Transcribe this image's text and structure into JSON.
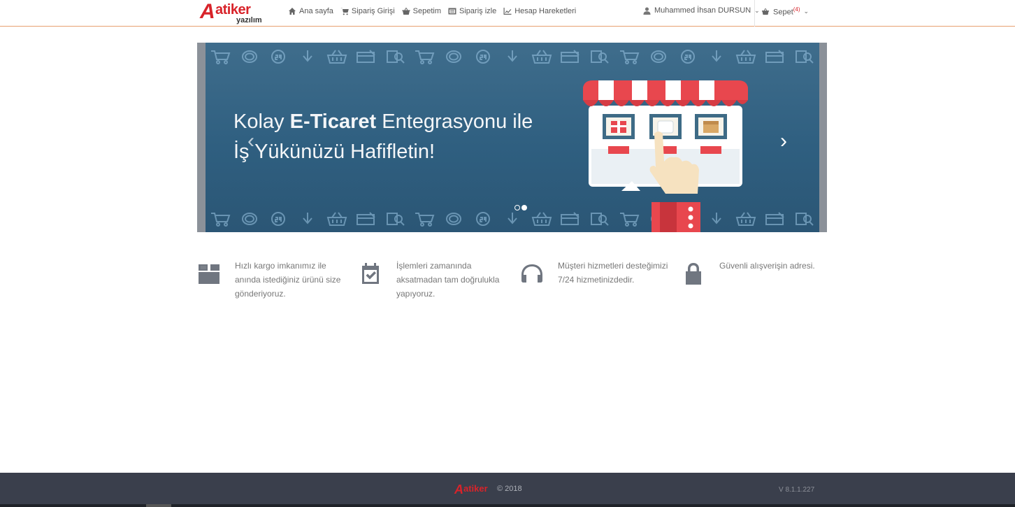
{
  "header": {
    "logo_text": "atiker",
    "logo_sub": "yazılım",
    "nav": [
      {
        "label": "Ana sayfa",
        "icon": "home-icon"
      },
      {
        "label": "Sipariş Girişi",
        "icon": "cart-icon"
      },
      {
        "label": "Sepetim",
        "icon": "basket-icon"
      },
      {
        "label": "Sipariş izle",
        "icon": "list-icon"
      },
      {
        "label": "Hesap Hareketleri",
        "icon": "chart-icon"
      }
    ],
    "user_name": "Muhammed İhsan DURSUN",
    "cart_label": "Sepet",
    "cart_count": "(4)",
    "accent_color": "#d8232a"
  },
  "carousel": {
    "headline_pre": "Kolay ",
    "headline_bold": "E-Ticaret",
    "headline_post": " Entegrasyonu ile",
    "headline_line2": "İş Yükünüzü Hafifletin!",
    "prev_label": "‹",
    "next_label": "›",
    "slide_count": 2,
    "active_slide": 2
  },
  "features": [
    {
      "icon": "box-icon",
      "text": "Hızlı kargo imkanımız ile anında istediğiniz ürünü size gönderiyoruz."
    },
    {
      "icon": "calendar-check-icon",
      "text": "İşlemleri zamanında aksatmadan tam doğrulukla yapıyoruz."
    },
    {
      "icon": "headphones-icon",
      "text": "Müşteri hizmetleri desteğimizi 7/24 hizmetinizdedir."
    },
    {
      "icon": "lock-icon",
      "text": "Güvenli alışverişin adresi."
    }
  ],
  "footer": {
    "logo_text": "atiker",
    "copyright": "© 2018",
    "version": "V 8.1.1.227"
  }
}
